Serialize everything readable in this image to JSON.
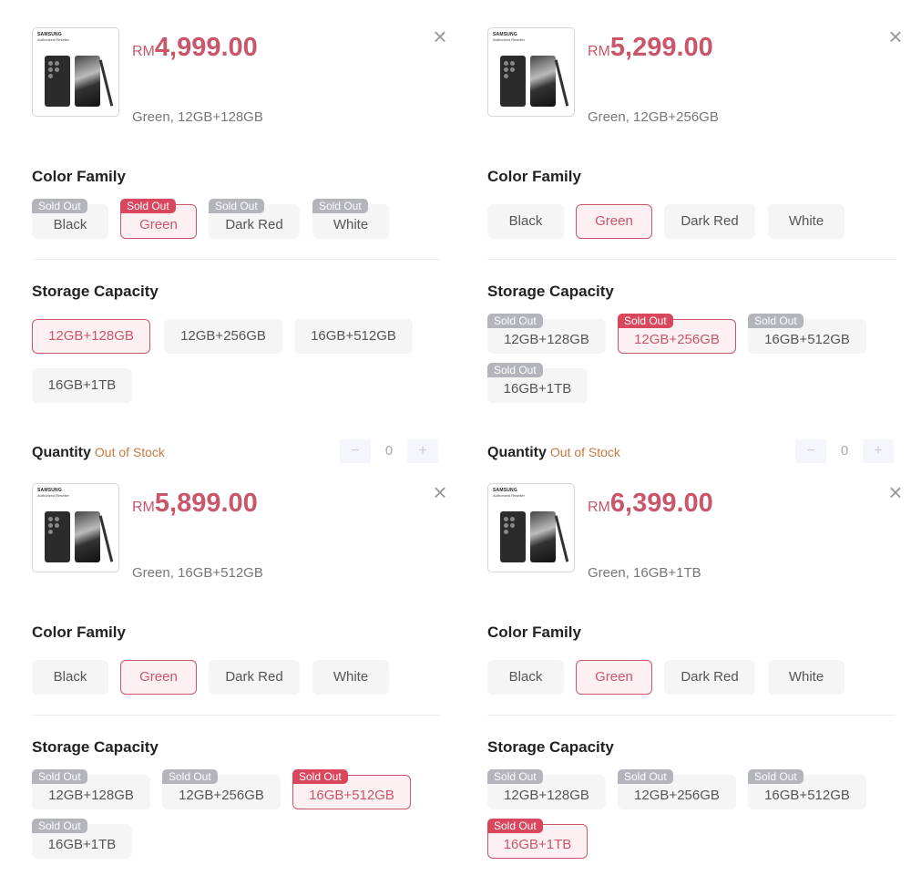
{
  "panels": [
    {
      "currency": "RM",
      "price": "4,999.00",
      "variant": "Green, 12GB+128GB",
      "thumb_brand": "SAMSUNG",
      "thumb_sub": "Authorized Reseller",
      "color_title": "Color Family",
      "colors": [
        {
          "label": "Black",
          "badge": "Sold Out"
        },
        {
          "label": "Green",
          "badge": "Sold Out"
        },
        {
          "label": "Dark Red",
          "badge": "Sold Out"
        },
        {
          "label": "White",
          "badge": "Sold Out"
        }
      ],
      "storage_title": "Storage Capacity",
      "storage": [
        {
          "label": "12GB+128GB",
          "badge": ""
        },
        {
          "label": "12GB+256GB",
          "badge": ""
        },
        {
          "label": "16GB+512GB",
          "badge": ""
        },
        {
          "label": "16GB+1TB",
          "badge": ""
        }
      ],
      "quantity_label": "Quantity",
      "stock_status": "Out of Stock",
      "quantity_value": "0",
      "minus": "−",
      "plus": "+",
      "close": "×"
    },
    {
      "currency": "RM",
      "price": "5,299.00",
      "variant": "Green, 12GB+256GB",
      "thumb_brand": "SAMSUNG",
      "thumb_sub": "Authorized Reseller",
      "color_title": "Color Family",
      "colors": [
        {
          "label": "Black",
          "badge": ""
        },
        {
          "label": "Green",
          "badge": ""
        },
        {
          "label": "Dark Red",
          "badge": ""
        },
        {
          "label": "White",
          "badge": ""
        }
      ],
      "storage_title": "Storage Capacity",
      "storage": [
        {
          "label": "12GB+128GB",
          "badge": "Sold Out"
        },
        {
          "label": "12GB+256GB",
          "badge": "Sold Out"
        },
        {
          "label": "16GB+512GB",
          "badge": "Sold Out"
        },
        {
          "label": "16GB+1TB",
          "badge": "Sold Out"
        }
      ],
      "quantity_label": "Quantity",
      "stock_status": "Out of Stock",
      "quantity_value": "0",
      "minus": "−",
      "plus": "+",
      "close": "×"
    },
    {
      "currency": "RM",
      "price": "5,899.00",
      "variant": "Green, 16GB+512GB",
      "thumb_brand": "SAMSUNG",
      "thumb_sub": "Authorized Reseller",
      "color_title": "Color Family",
      "colors": [
        {
          "label": "Black",
          "badge": ""
        },
        {
          "label": "Green",
          "badge": ""
        },
        {
          "label": "Dark Red",
          "badge": ""
        },
        {
          "label": "White",
          "badge": ""
        }
      ],
      "storage_title": "Storage Capacity",
      "storage": [
        {
          "label": "12GB+128GB",
          "badge": "Sold Out"
        },
        {
          "label": "12GB+256GB",
          "badge": "Sold Out"
        },
        {
          "label": "16GB+512GB",
          "badge": "Sold Out"
        },
        {
          "label": "16GB+1TB",
          "badge": "Sold Out"
        }
      ],
      "close": "×"
    },
    {
      "currency": "RM",
      "price": "6,399.00",
      "variant": "Green, 16GB+1TB",
      "thumb_brand": "SAMSUNG",
      "thumb_sub": "Authorized Reseller",
      "color_title": "Color Family",
      "colors": [
        {
          "label": "Black",
          "badge": ""
        },
        {
          "label": "Green",
          "badge": ""
        },
        {
          "label": "Dark Red",
          "badge": ""
        },
        {
          "label": "White",
          "badge": ""
        }
      ],
      "storage_title": "Storage Capacity",
      "storage": [
        {
          "label": "12GB+128GB",
          "badge": "Sold Out"
        },
        {
          "label": "12GB+256GB",
          "badge": "Sold Out"
        },
        {
          "label": "16GB+512GB",
          "badge": "Sold Out"
        },
        {
          "label": "16GB+1TB",
          "badge": "Sold Out"
        }
      ],
      "close": "×"
    }
  ],
  "colors": {
    "accent": "#c9566a",
    "sold_out_badge": "#b4b4bb",
    "sold_out_badge_selected": "#d9475e",
    "out_of_stock": "#c77a3e"
  }
}
